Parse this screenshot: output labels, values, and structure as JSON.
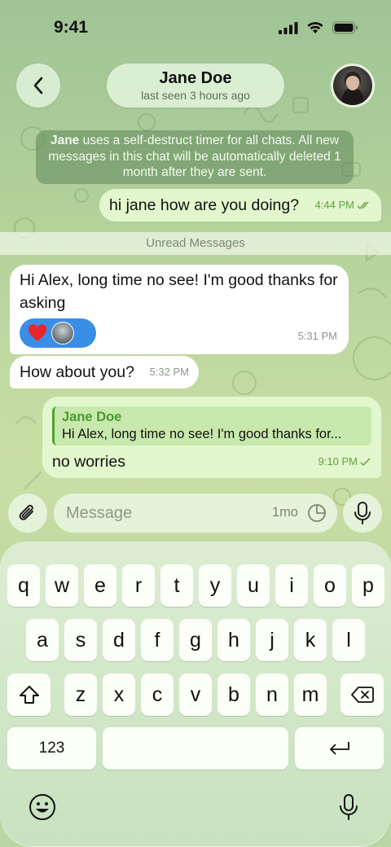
{
  "status_bar": {
    "time": "9:41"
  },
  "header": {
    "name": "Jane Doe",
    "last_seen": "last seen 3 hours ago"
  },
  "service_message": {
    "name": "Jane",
    "text": " uses a self-destruct timer for all chats. All new messages in this chat will be automatically deleted 1 month after they are sent."
  },
  "messages": [
    {
      "text": "hi jane how are you doing?",
      "time": "4:44 PM",
      "status": "read"
    },
    {
      "text": "Hi Alex, long time no see! I'm good thanks for asking",
      "time": "5:31 PM",
      "reaction": "❤️"
    },
    {
      "text": "How about you?",
      "time": "5:32 PM"
    },
    {
      "reply_name": "Jane Doe",
      "reply_text": "Hi Alex, long time no see! I'm good thanks for...",
      "text": "no worries",
      "time": "9:10 PM",
      "status": "sent"
    }
  ],
  "unread_label": "Unread Messages",
  "composer": {
    "placeholder": "Message",
    "timer": "1mo"
  },
  "keyboard": {
    "row1": [
      "q",
      "w",
      "e",
      "r",
      "t",
      "y",
      "u",
      "i",
      "o",
      "p"
    ],
    "row2": [
      "a",
      "s",
      "d",
      "f",
      "g",
      "h",
      "j",
      "k",
      "l"
    ],
    "row3": [
      "z",
      "x",
      "c",
      "v",
      "b",
      "n",
      "m"
    ],
    "numbers_label": "123"
  },
  "colors": {
    "outgoing_bubble": "#e2f7cd",
    "incoming_bubble": "#ffffff",
    "accent_green": "#4fa033",
    "reaction_blue": "#3a8ee6"
  },
  "icons": [
    "back-icon",
    "signal-icon",
    "wifi-icon",
    "battery-icon",
    "double-check-icon",
    "check-icon",
    "heart-icon",
    "attach-icon",
    "timer-icon",
    "mic-icon",
    "shift-icon",
    "backspace-icon",
    "return-icon",
    "emoji-icon",
    "dictation-icon"
  ]
}
